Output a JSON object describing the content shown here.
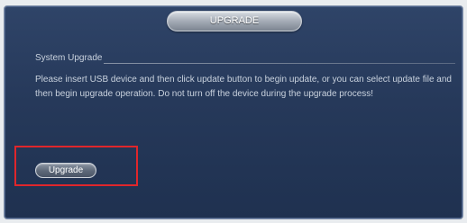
{
  "window": {
    "title": "UPGRADE"
  },
  "section": {
    "title": "System Upgrade",
    "description": "Please insert USB device and then click update button to begin update, or you can select update file and then begin upgrade operation. Do not turn off the device during the upgrade process!"
  },
  "actions": {
    "upgrade_label": "Upgrade"
  },
  "colors": {
    "highlight_border": "#e0262b",
    "window_background": "#26395a"
  }
}
